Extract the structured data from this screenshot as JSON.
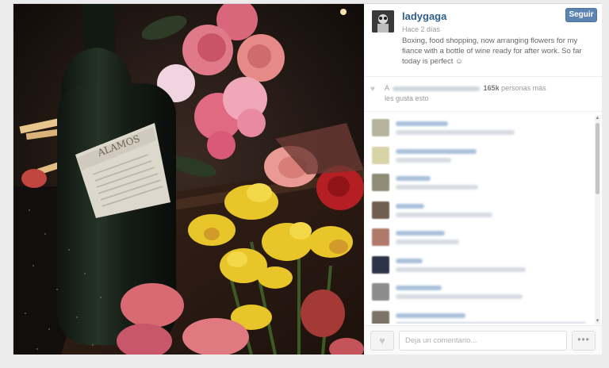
{
  "post": {
    "username": "ladygaga",
    "follow_label": "Seguir",
    "time": "Hace 2 días",
    "caption": "Boxing, food shopping, now arranging flowers for my fiance with a bottle of wine ready for after work. So far today is perfect ☺",
    "photo": {
      "bottle_label": "ALAMOS"
    }
  },
  "likes": {
    "prefix": "A",
    "count": "165k",
    "suffix_line1": "personas más",
    "line2": "les gusta esto"
  },
  "comments": [
    {
      "avatar_color": "#b6b39c",
      "name_width": 66,
      "text_width": 150
    },
    {
      "avatar_color": "#d9d4a8",
      "name_width": 102,
      "text_width": 70
    },
    {
      "avatar_color": "#8e8c76",
      "name_width": 44,
      "text_width": 104
    },
    {
      "avatar_color": "#6f5e52",
      "name_width": 36,
      "text_width": 122
    },
    {
      "avatar_color": "#b07a6a",
      "name_width": 62,
      "text_width": 80
    },
    {
      "avatar_color": "#2e3447",
      "name_width": 34,
      "text_width": 164
    },
    {
      "avatar_color": "#8a8c8e",
      "name_width": 58,
      "text_width": 160
    },
    {
      "avatar_color": "#7b7466",
      "name_width": 88,
      "text_width": 240
    }
  ],
  "footer": {
    "comment_placeholder": "Deja un comentario...",
    "more_label": "•••"
  },
  "icons": {
    "like": "heart-icon",
    "likes_heart": "heart-icon",
    "more": "ellipsis-icon"
  }
}
